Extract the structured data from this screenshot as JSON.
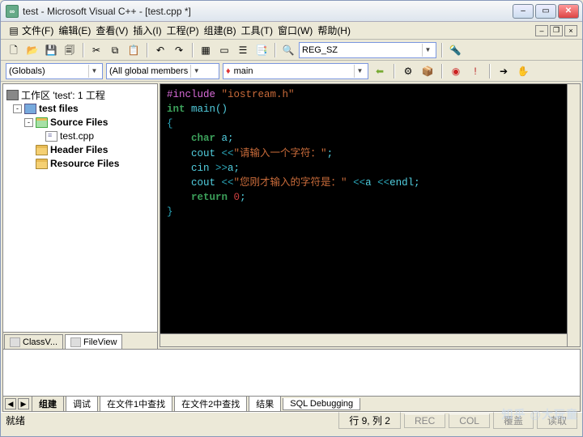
{
  "window": {
    "title": "test - Microsoft Visual C++ - [test.cpp *]"
  },
  "menu": {
    "file": "文件(F)",
    "edit": "编辑(E)",
    "view": "查看(V)",
    "insert": "插入(I)",
    "project": "工程(P)",
    "build": "组建(B)",
    "tools": "工具(T)",
    "window": "窗口(W)",
    "help": "帮助(H)"
  },
  "toolbar": {
    "combo_value": "REG_SZ"
  },
  "wizard": {
    "scope": "(Globals)",
    "members": "(All global members",
    "func": "main"
  },
  "tree": {
    "root": "工作区 'test': 1 工程",
    "project": "test files",
    "groups": [
      {
        "label": "Source Files",
        "open": true,
        "items": [
          "test.cpp"
        ]
      },
      {
        "label": "Header Files",
        "open": false,
        "items": []
      },
      {
        "label": "Resource Files",
        "open": false,
        "items": []
      }
    ],
    "tabs": {
      "classview": "ClassV...",
      "fileview": "FileView"
    }
  },
  "code": {
    "l1a": "#include",
    "l1b": "\"iostream.h\"",
    "l2a": "int",
    "l2b": " main()",
    "l3": "{",
    "l4a": "char",
    "l4b": " a;",
    "l5a": "cout ",
    "l5op": "<<",
    "l5b": "\"请输入一个字符：\"",
    "l5c": ";",
    "l6a": "cin ",
    "l6op": ">>",
    "l6b": "a;",
    "l7a": "cout ",
    "l7op1": "<<",
    "l7b": "\"您刚才输入的字符是：\"",
    "l7mid": " ",
    "l7op2": "<<",
    "l7c": "a ",
    "l7op3": "<<",
    "l7d": "endl;",
    "l8a": "return",
    "l8b": " ",
    "l8n": "0",
    "l8c": ";",
    "l9": "}"
  },
  "output": {
    "tabs": [
      "组建",
      "调试",
      "在文件1中查找",
      "在文件2中查找",
      "结果",
      "SQL Debugging"
    ]
  },
  "status": {
    "ready": "就绪",
    "pos": "行 9, 列 2",
    "ind": [
      "REC",
      "COL",
      "覆盖",
      "读取"
    ]
  },
  "watermark": "知乎 @大玩童"
}
